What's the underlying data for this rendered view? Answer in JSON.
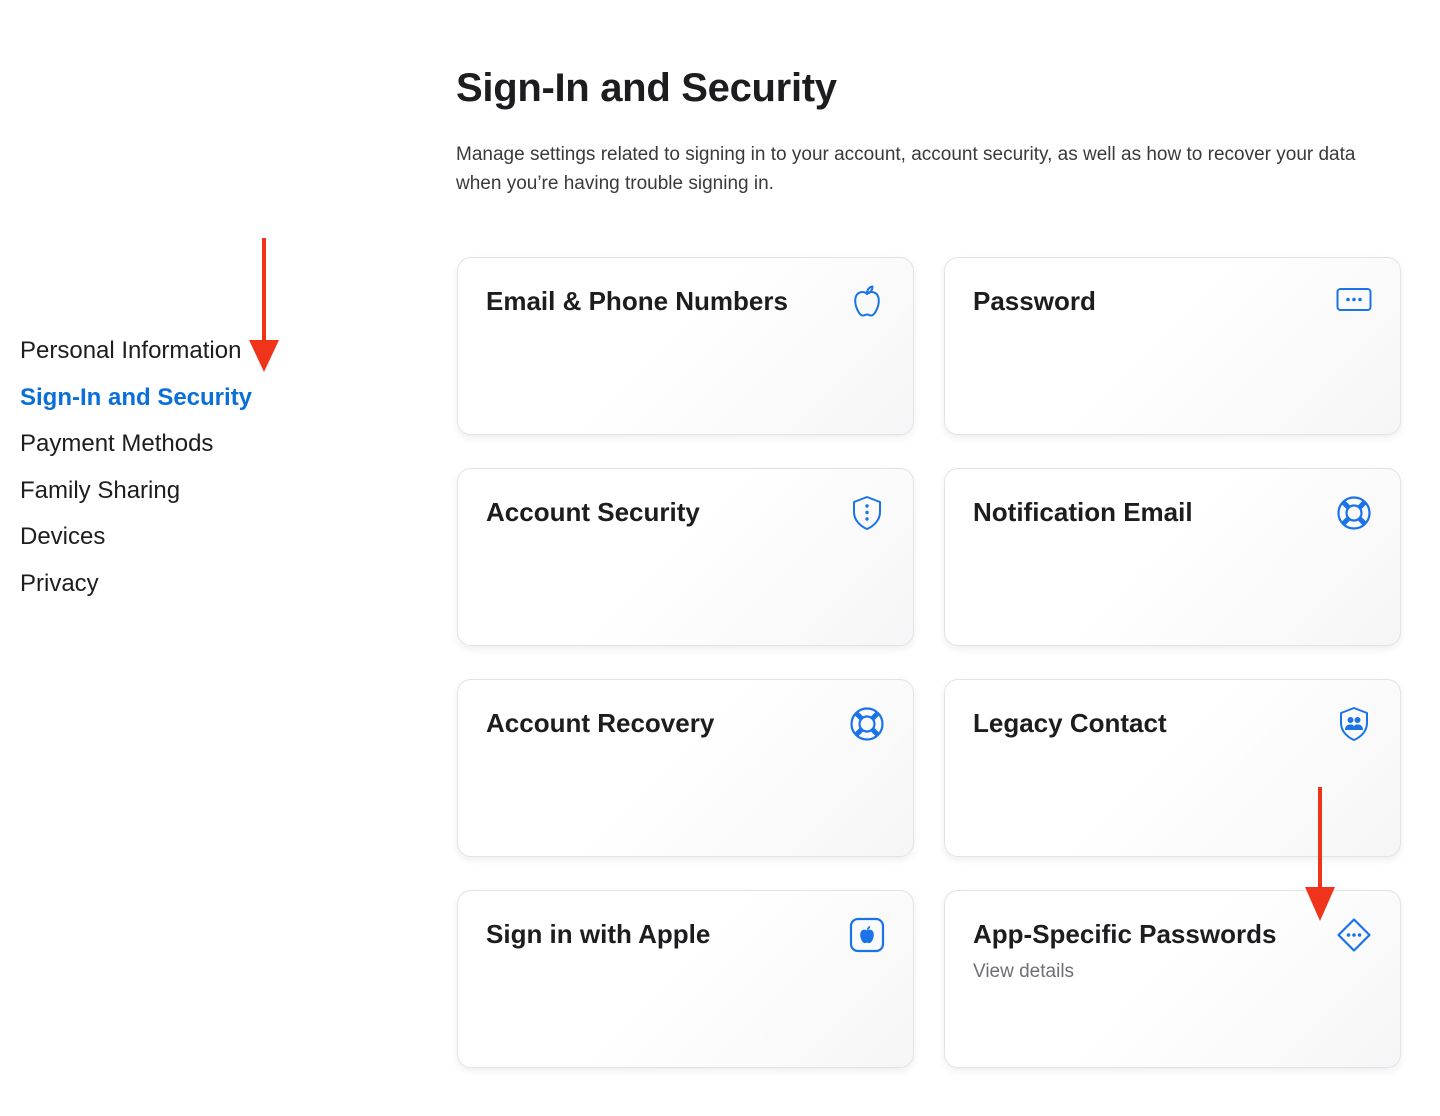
{
  "header": {
    "title": "Sign-In and Security",
    "description": "Manage settings related to signing in to your account, account security, as well as how to recover your data when you’re having trouble signing in."
  },
  "sidebar": {
    "items": [
      {
        "label": "Personal Information",
        "active": false
      },
      {
        "label": "Sign-In and Security",
        "active": true
      },
      {
        "label": "Payment Methods",
        "active": false
      },
      {
        "label": "Family Sharing",
        "active": false
      },
      {
        "label": "Devices",
        "active": false
      },
      {
        "label": "Privacy",
        "active": false
      }
    ]
  },
  "cards": [
    {
      "title": "Email & Phone Numbers",
      "icon": "apple-outline-icon"
    },
    {
      "title": "Password",
      "icon": "password-dots-icon"
    },
    {
      "title": "Account Security",
      "icon": "shield-icon"
    },
    {
      "title": "Notification Email",
      "icon": "lifebuoy-icon"
    },
    {
      "title": "Account Recovery",
      "icon": "lifebuoy-icon"
    },
    {
      "title": "Legacy Contact",
      "icon": "person-shield-icon"
    },
    {
      "title": "Sign in with Apple",
      "icon": "apple-square-icon"
    },
    {
      "title": "App-Specific Passwords",
      "subtitle": "View details",
      "icon": "diamond-dots-icon"
    }
  ],
  "colors": {
    "accent": "#0a6fd8",
    "icon": "#1a73e8",
    "annotation": "#f0341b",
    "text": "#1d1d1f",
    "muted": "#6e6e73"
  }
}
